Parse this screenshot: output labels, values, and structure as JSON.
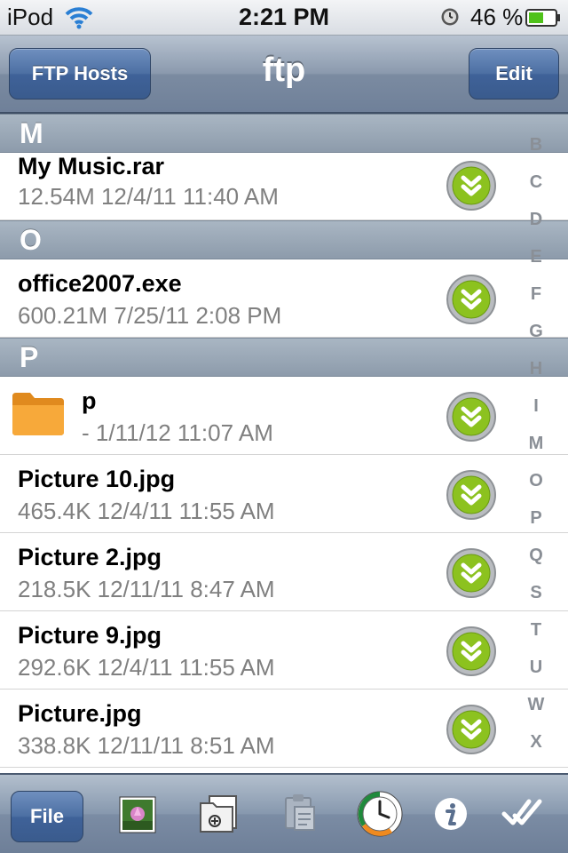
{
  "status": {
    "carrier": "iPod",
    "time": "2:21 PM",
    "battery": "46 %"
  },
  "nav": {
    "left_button": "FTP Hosts",
    "title": "ftp",
    "right_button": "Edit"
  },
  "sections": [
    {
      "letter": "M",
      "items": [
        {
          "name": "My Music.rar",
          "meta": "12.54M 12/4/11 11:40 AM"
        }
      ]
    },
    {
      "letter": "O",
      "items": [
        {
          "name": "office2007.exe",
          "meta": "600.21M 7/25/11 2:08 PM"
        }
      ]
    },
    {
      "letter": "P",
      "items": [
        {
          "name": "p",
          "meta": "- 1/11/12 11:07 AM",
          "type": "folder"
        },
        {
          "name": "Picture 10.jpg",
          "meta": "465.4K 12/4/11 11:55 AM"
        },
        {
          "name": "Picture 2.jpg",
          "meta": "218.5K 12/11/11 8:47 AM"
        },
        {
          "name": "Picture 9.jpg",
          "meta": "292.6K 12/4/11 11:55 AM"
        },
        {
          "name": "Picture.jpg",
          "meta": "338.8K 12/11/11 8:51 AM"
        }
      ]
    }
  ],
  "index_letters": [
    "B",
    "C",
    "D",
    "E",
    "F",
    "G",
    "H",
    "I",
    "M",
    "O",
    "P",
    "Q",
    "S",
    "T",
    "U",
    "W",
    "X"
  ],
  "toolbar": {
    "file_button": "File",
    "icons": [
      "photo-icon",
      "new-folder-icon",
      "paste-icon",
      "history-clock-icon",
      "info-icon",
      "select-checkmark-icon"
    ]
  },
  "colors": {
    "download_green": "#8cc21f",
    "nav_blue": "#4c6fa3",
    "meta_gray": "#808080"
  }
}
